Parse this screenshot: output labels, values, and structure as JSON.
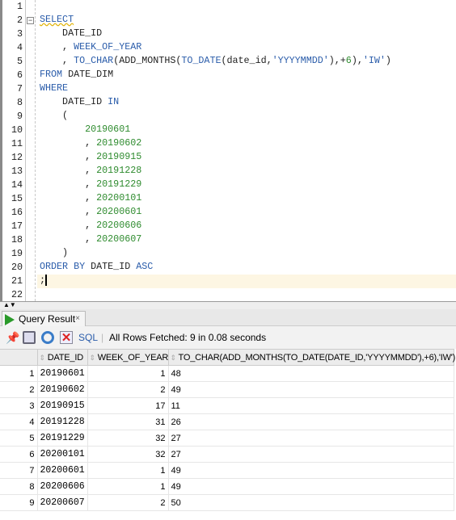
{
  "editor": {
    "current_line": 21,
    "lines": [
      [],
      [
        [
          "kw",
          "SELECT"
        ]
      ],
      [
        [
          "t",
          "    DATE_ID"
        ]
      ],
      [
        [
          "t",
          "    , "
        ],
        [
          "kw",
          "WEEK_OF_YEAR"
        ]
      ],
      [
        [
          "t",
          "    , "
        ],
        [
          "kw",
          "TO_CHAR"
        ],
        [
          "t",
          "(ADD_MONTHS("
        ],
        [
          "kw",
          "TO_DATE"
        ],
        [
          "t",
          "(date_id,"
        ],
        [
          "str",
          "'YYYYMMDD'"
        ],
        [
          "t",
          "),+"
        ],
        [
          "num",
          "6"
        ],
        [
          "t",
          "),"
        ],
        [
          "str",
          "'IW'"
        ],
        [
          "t",
          ")"
        ]
      ],
      [
        [
          "kw",
          "FROM"
        ],
        [
          "t",
          " DATE_DIM"
        ]
      ],
      [
        [
          "kw",
          "WHERE"
        ]
      ],
      [
        [
          "t",
          "    DATE_ID "
        ],
        [
          "kw",
          "IN"
        ]
      ],
      [
        [
          "t",
          "    ("
        ]
      ],
      [
        [
          "t",
          "        "
        ],
        [
          "num",
          "20190601"
        ]
      ],
      [
        [
          "t",
          "        , "
        ],
        [
          "num",
          "20190602"
        ]
      ],
      [
        [
          "t",
          "        , "
        ],
        [
          "num",
          "20190915"
        ]
      ],
      [
        [
          "t",
          "        , "
        ],
        [
          "num",
          "20191228"
        ]
      ],
      [
        [
          "t",
          "        , "
        ],
        [
          "num",
          "20191229"
        ]
      ],
      [
        [
          "t",
          "        , "
        ],
        [
          "num",
          "20200101"
        ]
      ],
      [
        [
          "t",
          "        , "
        ],
        [
          "num",
          "20200601"
        ]
      ],
      [
        [
          "t",
          "        , "
        ],
        [
          "num",
          "20200606"
        ]
      ],
      [
        [
          "t",
          "        , "
        ],
        [
          "num",
          "20200607"
        ]
      ],
      [
        [
          "t",
          "    )"
        ]
      ],
      [
        [
          "kw",
          "ORDER BY"
        ],
        [
          "t",
          " DATE_ID "
        ],
        [
          "kw",
          "ASC"
        ]
      ],
      [
        [
          "t",
          ";"
        ]
      ],
      []
    ]
  },
  "results": {
    "tab_label": "Query Result",
    "tab_close": "×",
    "sql_label": "SQL",
    "status": "All Rows Fetched: 9 in 0.08 seconds",
    "columns": [
      "DATE_ID",
      "WEEK_OF_YEAR",
      "TO_CHAR(ADD_MONTHS(TO_DATE(DATE_ID,'YYYYMMDD'),+6),'IW')"
    ],
    "rows": [
      [
        "1",
        "20190601",
        "1",
        "48"
      ],
      [
        "2",
        "20190602",
        "2",
        "49"
      ],
      [
        "3",
        "20190915",
        "17",
        "11"
      ],
      [
        "4",
        "20191228",
        "31",
        "26"
      ],
      [
        "5",
        "20191229",
        "32",
        "27"
      ],
      [
        "6",
        "20200101",
        "32",
        "27"
      ],
      [
        "7",
        "20200601",
        "1",
        "49"
      ],
      [
        "8",
        "20200606",
        "1",
        "49"
      ],
      [
        "9",
        "20200607",
        "2",
        "50"
      ]
    ]
  }
}
